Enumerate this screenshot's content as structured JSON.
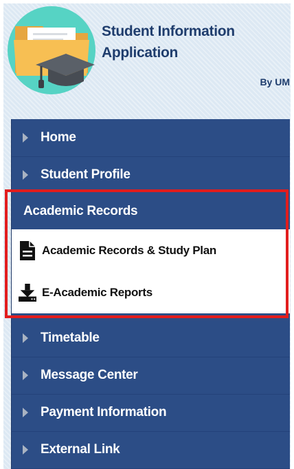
{
  "app": {
    "title_line1": "Student Information",
    "title_line2": "Application",
    "by_line": "By UM",
    "logo_icon": "folder-graduation-cap-icon"
  },
  "menu": {
    "items_top": [
      {
        "label": "Home",
        "icon": "triangle-right-icon"
      },
      {
        "label": "Student Profile",
        "icon": "triangle-right-icon"
      }
    ],
    "active_section": {
      "label": "Academic Records",
      "subitems": [
        {
          "label": "Academic Records & Study Plan",
          "icon": "document-icon"
        },
        {
          "label": "E-Academic Reports",
          "icon": "download-icon"
        }
      ]
    },
    "items_bottom": [
      {
        "label": "Timetable",
        "icon": "triangle-right-icon"
      },
      {
        "label": "Message Center",
        "icon": "triangle-right-icon"
      },
      {
        "label": "Payment Information",
        "icon": "triangle-right-icon"
      },
      {
        "label": "External Link",
        "icon": "triangle-right-icon"
      }
    ]
  },
  "colors": {
    "menu_bg": "#2c4d86",
    "header_bg": "#dce8f3",
    "title_text": "#1f3d6d",
    "highlight_border": "#e21d1d"
  }
}
